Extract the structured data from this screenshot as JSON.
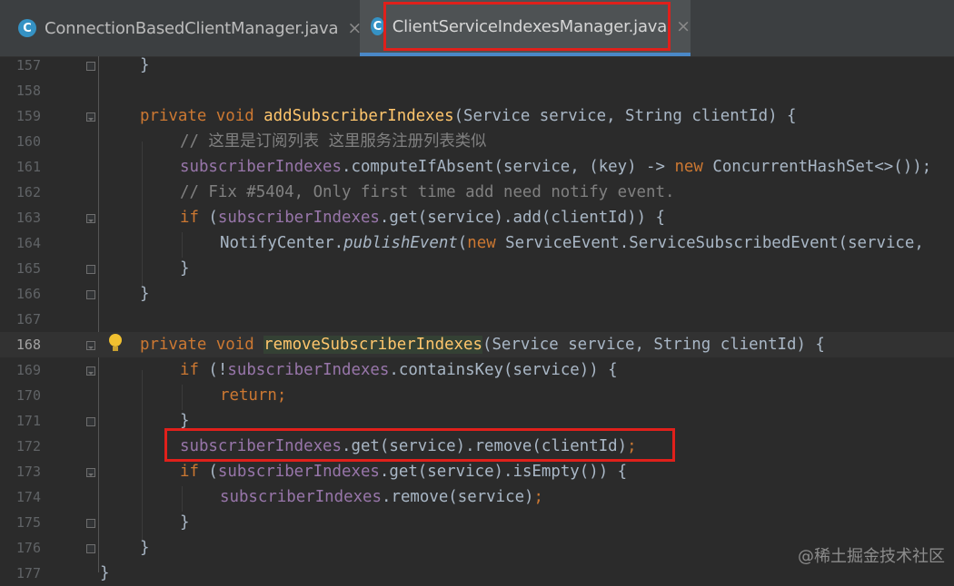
{
  "tabs": [
    {
      "label": "ConnectionBasedClientManager.java",
      "icon": "class-icon",
      "icon_letter": "C",
      "active": false
    },
    {
      "label": "ClientServiceIndexesManager.java",
      "icon": "class-icon",
      "icon_letter": "C",
      "active": true
    }
  ],
  "close_glyph": "×",
  "current_line": 168,
  "lines": [
    {
      "n": "157"
    },
    {
      "n": "158"
    },
    {
      "n": "159"
    },
    {
      "n": "160"
    },
    {
      "n": "161"
    },
    {
      "n": "162"
    },
    {
      "n": "163"
    },
    {
      "n": "164"
    },
    {
      "n": "165"
    },
    {
      "n": "166"
    },
    {
      "n": "167"
    },
    {
      "n": "168"
    },
    {
      "n": "169"
    },
    {
      "n": "170"
    },
    {
      "n": "171"
    },
    {
      "n": "172"
    },
    {
      "n": "173"
    },
    {
      "n": "174"
    },
    {
      "n": "175"
    },
    {
      "n": "176"
    },
    {
      "n": "177"
    }
  ],
  "code": {
    "l157": {
      "brace": "}"
    },
    "l159": {
      "private": "private",
      "void": "void",
      "name": "addSubscriberIndexes",
      "params": "(Service service, String clientId) {"
    },
    "l160": {
      "comment": "// 这里是订阅列表 这里服务注册列表类似"
    },
    "l161": {
      "field": "subscriberIndexes",
      "rest1": ".computeIfAbsent(service, (key) -> ",
      "new": "new",
      "rest2": " ConcurrentHashSet<>());"
    },
    "l162": {
      "comment": "// Fix #5404, Only first time add need notify event."
    },
    "l163": {
      "if": "if",
      "p1": " (",
      "field": "subscriberIndexes",
      "rest": ".get(service).add(clientId)) {"
    },
    "l164": {
      "cls": "NotifyCenter.",
      "method": "publishEvent",
      "p1": "(",
      "new": "new",
      "rest": " ServiceEvent.ServiceSubscribedEvent(service,"
    },
    "l165": {
      "brace": "}"
    },
    "l166": {
      "brace": "}"
    },
    "l168": {
      "private": "private",
      "void": "void",
      "name": "removeSubscriberIndexes",
      "params": "(Service service, String clientId) {"
    },
    "l169": {
      "if": "if",
      "p1": " (!",
      "field": "subscriberIndexes",
      "rest": ".containsKey(service)) {"
    },
    "l170": {
      "return": "return;"
    },
    "l171": {
      "brace": "}"
    },
    "l172": {
      "field": "subscriberIndexes",
      "rest": ".get(service).remove(clientId)",
      "semi": ";"
    },
    "l173": {
      "if": "if",
      "p1": " (",
      "field": "subscriberIndexes",
      "rest": ".get(service).isEmpty()) {"
    },
    "l174": {
      "field": "subscriberIndexes",
      "rest": ".remove(service)",
      "semi": ";"
    },
    "l175": {
      "brace": "}"
    },
    "l176": {
      "brace": "}"
    },
    "l177": {
      "brace": "}"
    }
  },
  "watermark": "@稀土掘金技术社区",
  "colors": {
    "highlight_box": "#e0201b",
    "keyword": "#cc7832",
    "method": "#ffc66d",
    "field": "#9876aa",
    "comment": "#808080"
  }
}
